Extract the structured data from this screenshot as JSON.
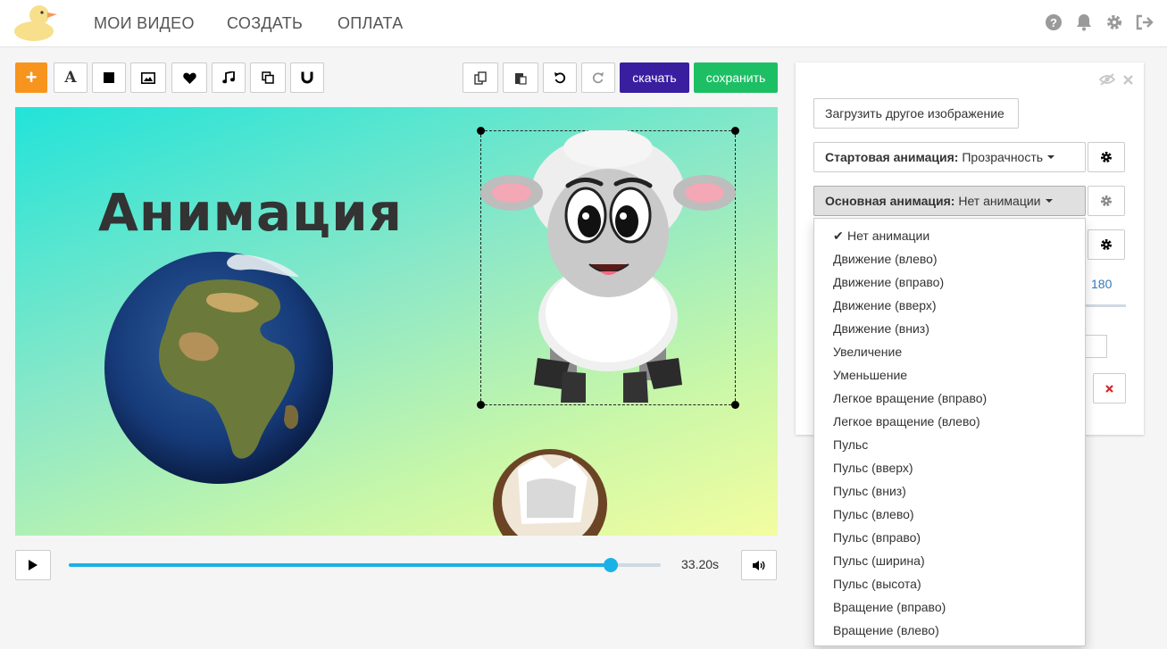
{
  "nav": {
    "items": [
      "МОИ ВИДЕО",
      "СОЗДАТЬ",
      "ОПЛАТА"
    ],
    "icons": [
      "help-icon",
      "bell-icon",
      "gear-icon",
      "logout-icon"
    ]
  },
  "toolbar": {
    "add_label": "+",
    "text_label": "A",
    "download_label": "скачать",
    "save_label": "сохранить"
  },
  "canvas": {
    "title": "Анимация"
  },
  "player": {
    "time": "33.20s",
    "progress": 0.915
  },
  "panel": {
    "upload_label": "Загрузить другое изображение",
    "start_anim_key": "Стартовая анимация:",
    "start_anim_value": "Прозрачность",
    "main_anim_key": "Основная анимация:",
    "main_anim_value": "Нет анимации",
    "value_180": "180"
  },
  "dropdown": {
    "selected_index": 0,
    "options": [
      "Нет анимации",
      "Движение (влево)",
      "Движение (вправо)",
      "Движение (вверх)",
      "Движение (вниз)",
      "Увеличение",
      "Уменьшение",
      "Легкое вращение (вправо)",
      "Легкое вращение (влево)",
      "Пульс",
      "Пульс (вверх)",
      "Пульс (вниз)",
      "Пульс (влево)",
      "Пульс (вправо)",
      "Пульс (ширина)",
      "Пульс (высота)",
      "Вращение (вправо)",
      "Вращение (влево)"
    ]
  },
  "colors": {
    "accent_orange": "#f7941d",
    "download_purple": "#3a1ea0",
    "save_green": "#1dbf64",
    "progress_blue": "#1ab1e6"
  }
}
